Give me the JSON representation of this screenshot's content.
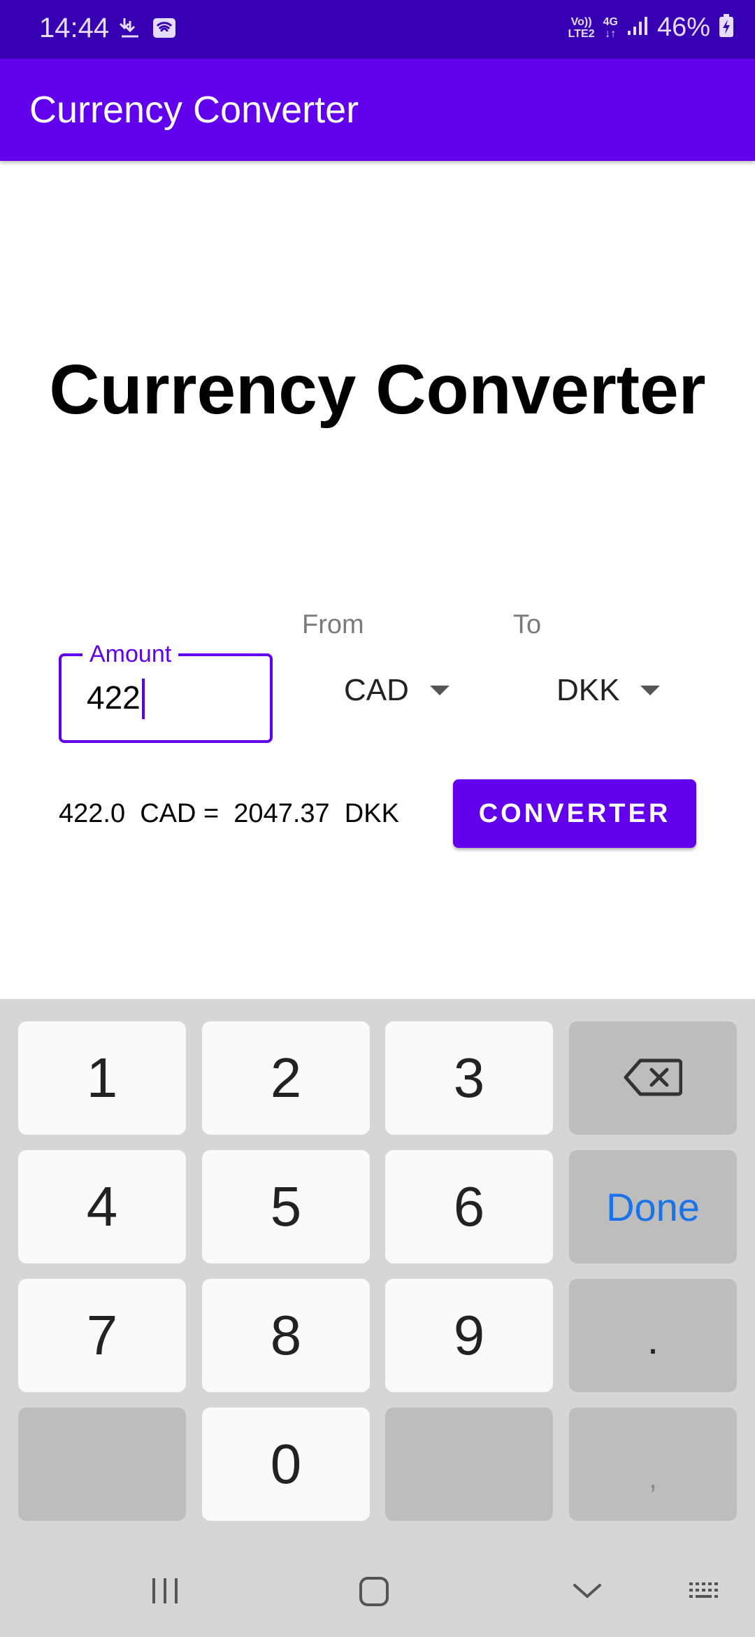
{
  "status_bar": {
    "time": "14:44",
    "network_top": "Vo))",
    "network_bottom": "LTE2",
    "network_4g": "4G",
    "battery": "46%"
  },
  "app_bar": {
    "title": "Currency Converter"
  },
  "main": {
    "heading": "Currency Converter",
    "amount_label": "Amount",
    "amount_value": "422",
    "from_label": "From",
    "to_label": "To",
    "from_currency": "CAD",
    "to_currency": "DKK",
    "result": "422.0  CAD =  2047.37  DKK",
    "convert_label": "CONVERTER"
  },
  "keyboard": {
    "keys": [
      "1",
      "2",
      "3",
      "4",
      "5",
      "6",
      "7",
      "8",
      "9",
      "0"
    ],
    "done_label": "Done",
    "dot": ".",
    "comma": ","
  },
  "colors": {
    "primary": "#6200ee",
    "primary_dark": "#3700b3",
    "done_blue": "#1a73e8"
  }
}
